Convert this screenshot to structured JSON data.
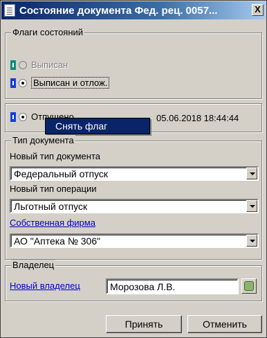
{
  "window": {
    "title": "Состояние документа Фед. рец. 0057...",
    "close_glyph": "X"
  },
  "flags": {
    "legend": "Флаги состояний",
    "items": [
      {
        "label": "Выписан",
        "state": "disabled"
      },
      {
        "label": "Выписан и отлож.",
        "state": "checked"
      }
    ]
  },
  "sent": {
    "label": "Отпущено",
    "timestamp": "05.06.2018 18:44:44"
  },
  "context_menu": {
    "item": "Снять флаг"
  },
  "doc_type": {
    "legend": "Тип документа",
    "new_doc_type_label": "Новый тип документа",
    "new_doc_type_value": "Федеральный отпуск",
    "new_op_type_label": "Новый тип операции",
    "new_op_type_value": "Льготный отпуск",
    "own_firm_link": "Собственная фирма",
    "own_firm_value": "АО \"Аптека № 306\""
  },
  "owner": {
    "legend": "Владелец",
    "new_owner_link": "Новый владелец",
    "new_owner_value": "Морозова Л.В."
  },
  "buttons": {
    "accept": "Принять",
    "cancel": "Отменить"
  },
  "colors": {
    "title_start": "#0a246a",
    "title_end": "#a6caf0",
    "menu_highlight": "#0a246a",
    "link": "#0000cc"
  }
}
